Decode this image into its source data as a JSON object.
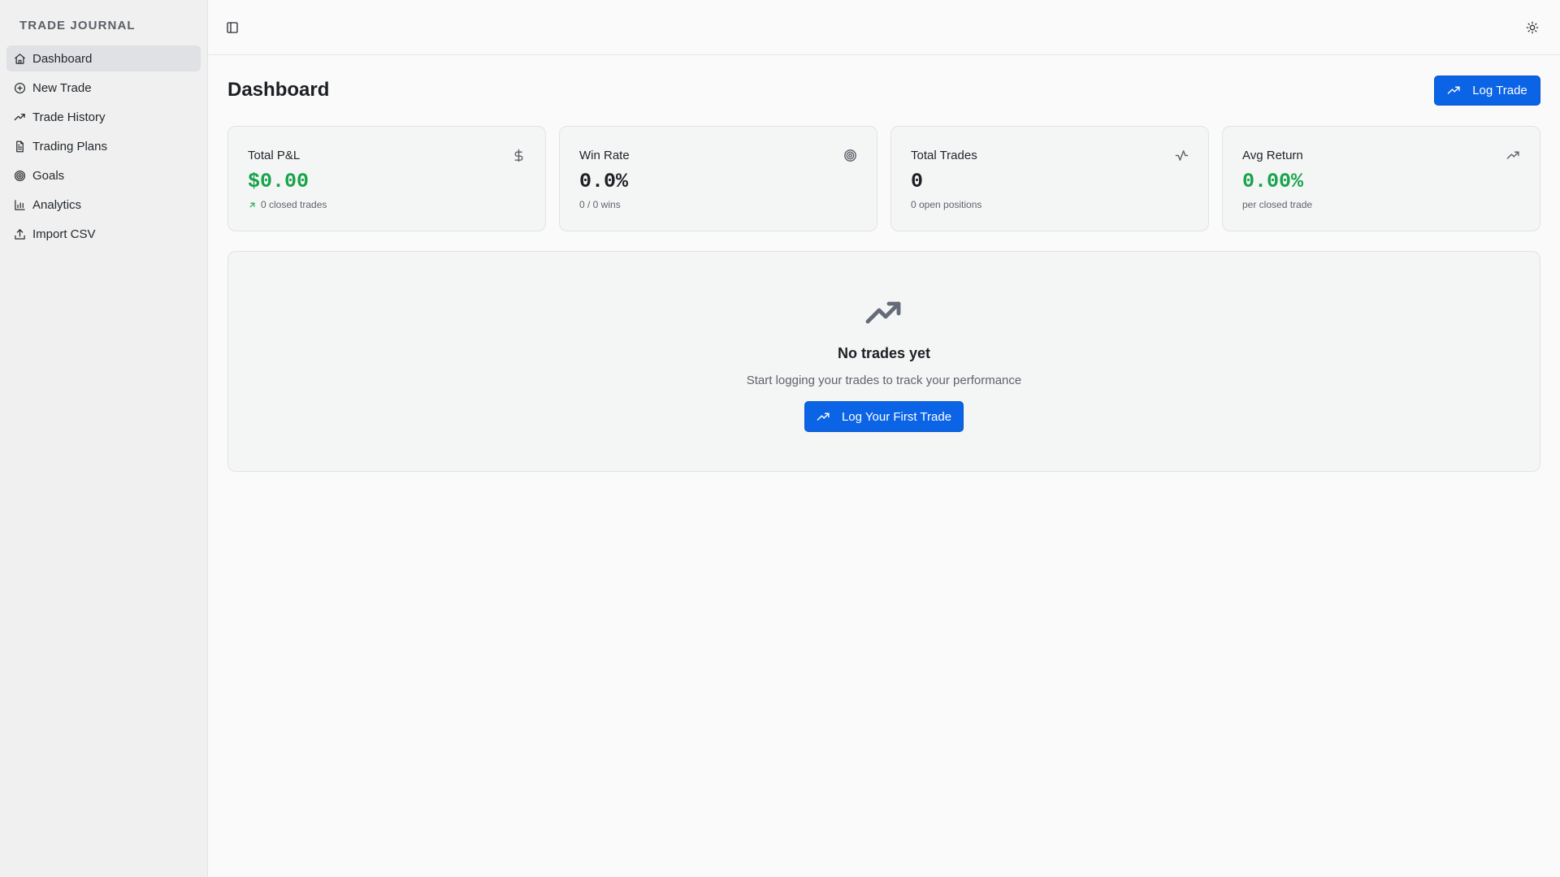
{
  "sidebar": {
    "brand": "TRADE JOURNAL",
    "items": [
      {
        "label": "Dashboard",
        "icon": "home-icon",
        "active": true
      },
      {
        "label": "New Trade",
        "icon": "plus-circle-icon"
      },
      {
        "label": "Trade History",
        "icon": "trending-up-icon"
      },
      {
        "label": "Trading Plans",
        "icon": "file-text-icon"
      },
      {
        "label": "Goals",
        "icon": "target-icon"
      },
      {
        "label": "Analytics",
        "icon": "bar-chart-icon"
      },
      {
        "label": "Import CSV",
        "icon": "upload-icon"
      }
    ]
  },
  "topbar": {
    "toggle_icon": "sidebar-toggle-icon",
    "theme_icon": "sun-icon"
  },
  "main": {
    "title": "Dashboard",
    "log_trade_label": "Log Trade",
    "stats": [
      {
        "title": "Total P&L",
        "value": "$0.00",
        "sub": "0 closed trades",
        "icon": "dollar-icon",
        "value_color": "#16a34a"
      },
      {
        "title": "Win Rate",
        "value": "0.0%",
        "sub": "0 / 0 wins",
        "icon": "target-icon"
      },
      {
        "title": "Total Trades",
        "value": "0",
        "sub": "0 open positions",
        "icon": "activity-icon"
      },
      {
        "title": "Avg Return",
        "value": "0.00%",
        "sub": "per closed trade",
        "icon": "trending-up-icon",
        "value_color": "#16a34a"
      }
    ],
    "empty_state": {
      "icon": "trending-up-icon",
      "title": "No trades yet",
      "text": "Start logging your trades to track your performance",
      "button_label": "Log Your First Trade"
    }
  },
  "colors": {
    "accent": "#0b63e5",
    "positive": "#16a34a"
  }
}
